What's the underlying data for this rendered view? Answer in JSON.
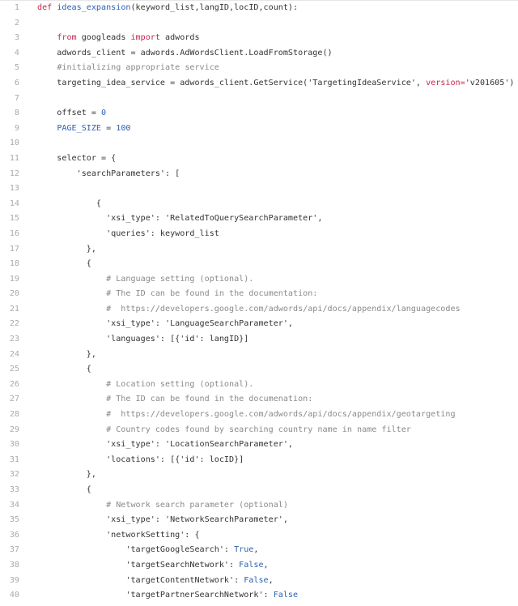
{
  "colors": {
    "keyword": "#c7254e",
    "function": "#2d62b3",
    "number": "#2d62b3",
    "comment": "#8a8a8a",
    "text": "#333333"
  },
  "lines": [
    {
      "num": "1",
      "tokens": [
        [
          "def ",
          "k"
        ],
        [
          "ideas_expansion",
          "f"
        ],
        [
          "(keyword_list,langID,locID,count):",
          "t"
        ]
      ]
    },
    {
      "num": "2",
      "tokens": []
    },
    {
      "num": "3",
      "tokens": [
        [
          "    ",
          "t"
        ],
        [
          "from",
          "k"
        ],
        [
          " googleads ",
          "t"
        ],
        [
          "import",
          "k"
        ],
        [
          " adwords",
          "t"
        ]
      ]
    },
    {
      "num": "4",
      "tokens": [
        [
          "    adwords_client = adwords.AdWordsClient.LoadFromStorage()",
          "t"
        ]
      ]
    },
    {
      "num": "5",
      "tokens": [
        [
          "    ",
          "t"
        ],
        [
          "#initializing appropriate service",
          "c"
        ]
      ]
    },
    {
      "num": "6",
      "tokens": [
        [
          "    targeting_idea_service = adwords_client.GetService('TargetingIdeaService', ",
          "t"
        ],
        [
          "version=",
          "k"
        ],
        [
          "'v201605')",
          "t"
        ]
      ]
    },
    {
      "num": "7",
      "tokens": []
    },
    {
      "num": "8",
      "tokens": [
        [
          "    offset = ",
          "t"
        ],
        [
          "0",
          "n"
        ]
      ]
    },
    {
      "num": "9",
      "tokens": [
        [
          "    ",
          "t"
        ],
        [
          "PAGE_SIZE",
          "n"
        ],
        [
          " = ",
          "t"
        ],
        [
          "100",
          "n"
        ]
      ]
    },
    {
      "num": "10",
      "tokens": []
    },
    {
      "num": "11",
      "tokens": [
        [
          "    selector = {",
          "t"
        ]
      ]
    },
    {
      "num": "12",
      "tokens": [
        [
          "        'searchParameters': [",
          "t"
        ]
      ]
    },
    {
      "num": "13",
      "tokens": []
    },
    {
      "num": "14",
      "tokens": [
        [
          "            {",
          "t"
        ]
      ]
    },
    {
      "num": "15",
      "tokens": [
        [
          "              'xsi_type': 'RelatedToQuerySearchParameter',",
          "t"
        ]
      ]
    },
    {
      "num": "16",
      "tokens": [
        [
          "              'queries': keyword_list",
          "t"
        ]
      ]
    },
    {
      "num": "17",
      "tokens": [
        [
          "          },",
          "t"
        ]
      ]
    },
    {
      "num": "18",
      "tokens": [
        [
          "          {",
          "t"
        ]
      ]
    },
    {
      "num": "19",
      "tokens": [
        [
          "              ",
          "t"
        ],
        [
          "# Language setting (optional).",
          "c"
        ]
      ]
    },
    {
      "num": "20",
      "tokens": [
        [
          "              ",
          "t"
        ],
        [
          "# The ID can be found in the documentation:",
          "c"
        ]
      ]
    },
    {
      "num": "21",
      "tokens": [
        [
          "              ",
          "t"
        ],
        [
          "#  https://developers.google.com/adwords/api/docs/appendix/languagecodes",
          "c"
        ]
      ]
    },
    {
      "num": "22",
      "tokens": [
        [
          "              'xsi_type': 'LanguageSearchParameter',",
          "t"
        ]
      ]
    },
    {
      "num": "23",
      "tokens": [
        [
          "              'languages': [{'id': langID}]",
          "t"
        ]
      ]
    },
    {
      "num": "24",
      "tokens": [
        [
          "          },",
          "t"
        ]
      ]
    },
    {
      "num": "25",
      "tokens": [
        [
          "          {",
          "t"
        ]
      ]
    },
    {
      "num": "26",
      "tokens": [
        [
          "              ",
          "t"
        ],
        [
          "# Location setting (optional).",
          "c"
        ]
      ]
    },
    {
      "num": "27",
      "tokens": [
        [
          "              ",
          "t"
        ],
        [
          "# The ID can be found in the documenation:",
          "c"
        ]
      ]
    },
    {
      "num": "28",
      "tokens": [
        [
          "              ",
          "t"
        ],
        [
          "#  https://developers.google.com/adwords/api/docs/appendix/geotargeting",
          "c"
        ]
      ]
    },
    {
      "num": "29",
      "tokens": [
        [
          "              ",
          "t"
        ],
        [
          "# Country codes found by searching country name in name filter",
          "c"
        ]
      ]
    },
    {
      "num": "30",
      "tokens": [
        [
          "              'xsi_type': 'LocationSearchParameter',",
          "t"
        ]
      ]
    },
    {
      "num": "31",
      "tokens": [
        [
          "              'locations': [{'id': locID}]",
          "t"
        ]
      ]
    },
    {
      "num": "32",
      "tokens": [
        [
          "          },",
          "t"
        ]
      ]
    },
    {
      "num": "33",
      "tokens": [
        [
          "          {",
          "t"
        ]
      ]
    },
    {
      "num": "34",
      "tokens": [
        [
          "              ",
          "t"
        ],
        [
          "# Network search parameter (optional)",
          "c"
        ]
      ]
    },
    {
      "num": "35",
      "tokens": [
        [
          "              'xsi_type': 'NetworkSearchParameter',",
          "t"
        ]
      ]
    },
    {
      "num": "36",
      "tokens": [
        [
          "              'networkSetting': {",
          "t"
        ]
      ]
    },
    {
      "num": "37",
      "tokens": [
        [
          "                  'targetGoogleSearch': ",
          "t"
        ],
        [
          "True",
          "n"
        ],
        [
          ",",
          "t"
        ]
      ]
    },
    {
      "num": "38",
      "tokens": [
        [
          "                  'targetSearchNetwork': ",
          "t"
        ],
        [
          "False",
          "n"
        ],
        [
          ",",
          "t"
        ]
      ]
    },
    {
      "num": "39",
      "tokens": [
        [
          "                  'targetContentNetwork': ",
          "t"
        ],
        [
          "False",
          "n"
        ],
        [
          ",",
          "t"
        ]
      ]
    },
    {
      "num": "40",
      "tokens": [
        [
          "                  'targetPartnerSearchNetwork': ",
          "t"
        ],
        [
          "False",
          "n"
        ]
      ]
    }
  ]
}
